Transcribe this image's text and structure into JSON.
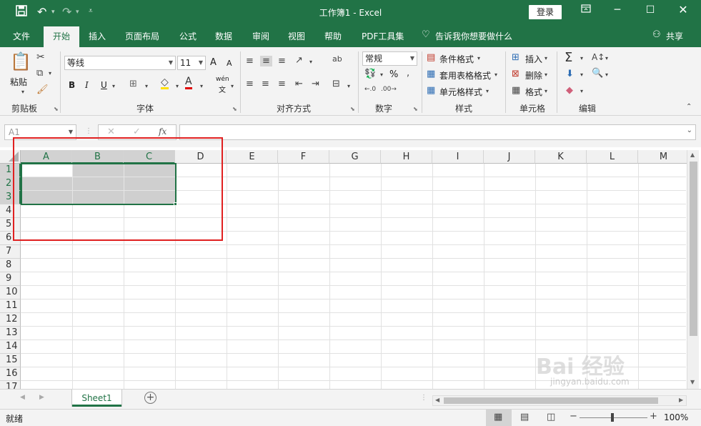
{
  "titlebar": {
    "title": "工作簿1  -  Excel",
    "login": "登录",
    "save_icon": "save-icon",
    "undo_icon": "undo-icon",
    "redo_icon": "redo-icon"
  },
  "tabs": [
    "文件",
    "开始",
    "插入",
    "页面布局",
    "公式",
    "数据",
    "审阅",
    "视图",
    "帮助",
    "PDF工具集"
  ],
  "tell_me": "告诉我你想要做什么",
  "share": "共享",
  "ribbon": {
    "clipboard": {
      "paste": "粘贴",
      "label": "剪贴板"
    },
    "font": {
      "name": "等线",
      "size": "11",
      "label": "字体",
      "bold": "B",
      "italic": "I",
      "underline": "U",
      "grow": "A",
      "shrink": "A",
      "phonetic": "wén",
      "phonetic_char": "文"
    },
    "alignment": {
      "label": "对齐方式"
    },
    "number": {
      "format": "常规",
      "label": "数字",
      "percent": "%"
    },
    "styles": {
      "conditional": "条件格式",
      "table": "套用表格格式",
      "cell": "单元格样式",
      "label": "样式"
    },
    "cells": {
      "insert": "插入",
      "delete": "删除",
      "format": "格式",
      "label": "单元格"
    },
    "editing": {
      "label": "编辑"
    }
  },
  "formula_bar": {
    "name_box": "A1",
    "fx": "fx"
  },
  "grid": {
    "columns": [
      "A",
      "B",
      "C",
      "D",
      "E",
      "F",
      "G",
      "H",
      "I",
      "J",
      "K",
      "L",
      "M"
    ],
    "rows": [
      "1",
      "2",
      "3",
      "4",
      "5",
      "6",
      "7",
      "8",
      "9",
      "10",
      "11",
      "12",
      "13",
      "14",
      "15",
      "16",
      "17"
    ],
    "selected_columns": [
      "A",
      "B",
      "C"
    ],
    "selected_rows": [
      "1",
      "2",
      "3"
    ]
  },
  "sheet": {
    "tab": "Sheet1"
  },
  "status": {
    "ready": "就绪",
    "zoom": "100%"
  },
  "watermark": {
    "text": "Bai 经验",
    "sub": "jingyan.baidu.com"
  },
  "colors": {
    "brand": "#217346",
    "highlight": "#e02020",
    "selection": "#cfcfcf"
  }
}
